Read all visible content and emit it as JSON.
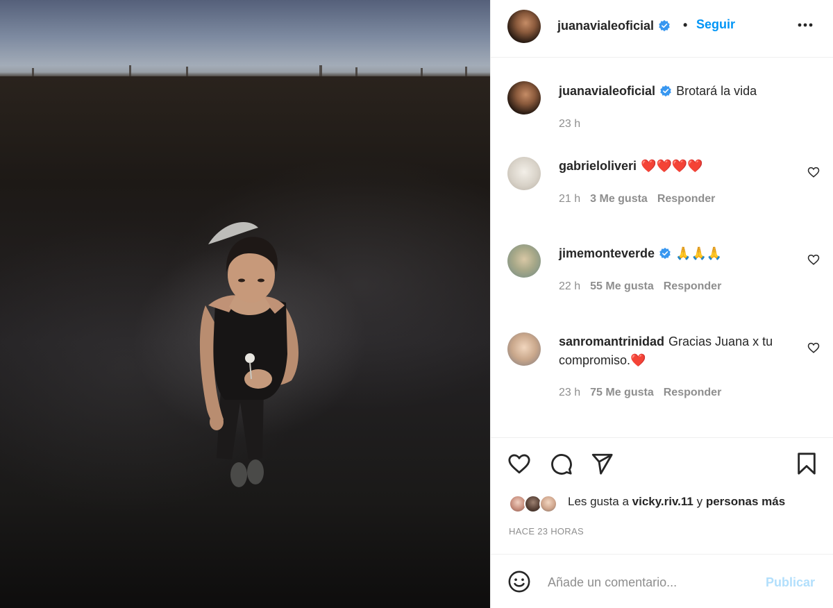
{
  "post": {
    "owner": "juanavialeoficial",
    "follow_label": "Seguir",
    "separator": "•",
    "caption": "Brotará la vida",
    "caption_time": "23 h"
  },
  "comments": [
    {
      "user": "gabrieloliveri",
      "text": "❤️❤️❤️❤️",
      "time": "21 h",
      "likes": "3 Me gusta",
      "reply": "Responder",
      "verified": false
    },
    {
      "user": "jimemonteverde",
      "text": "🙏🙏🙏",
      "time": "22 h",
      "likes": "55 Me gusta",
      "reply": "Responder",
      "verified": true
    },
    {
      "user": "sanromantrinidad",
      "text": "Gracias Juana x tu compromiso.❤️",
      "time": "23 h",
      "likes": "75 Me gusta",
      "reply": "Responder",
      "verified": false
    }
  ],
  "likes_summary": {
    "prefix": "Les gusta a",
    "user": "vicky.riv.11",
    "connector": "y",
    "suffix": "personas más"
  },
  "timestamp": "HACE 23 HORAS",
  "add_comment": {
    "placeholder": "Añade un comentario...",
    "publish_label": "Publicar"
  },
  "colors": {
    "accent": "#0095f6",
    "publish_disabled": "#b2dffc",
    "muted": "#8e8e8e",
    "text": "#262626",
    "heart_red": "#ed4956"
  }
}
